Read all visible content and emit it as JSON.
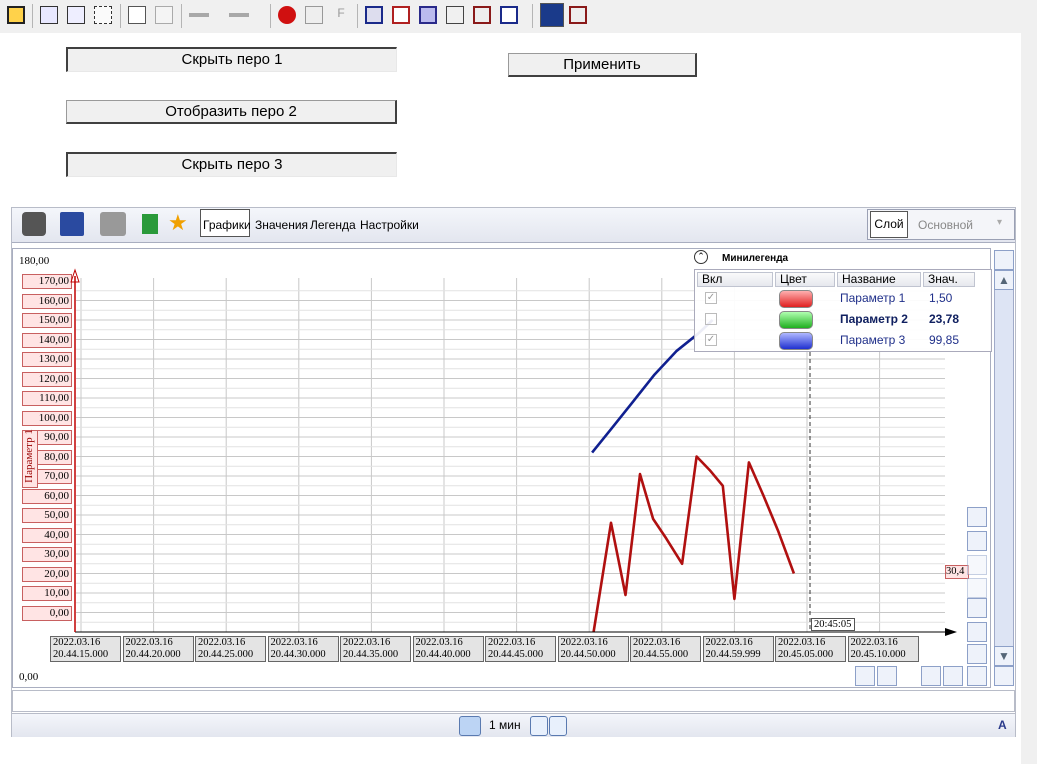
{
  "buttons": {
    "hide_pen_1": "Скрыть перо 1",
    "show_pen_2": "Отобразить перо 2",
    "hide_pen_3": "Скрыть перо 3",
    "apply": "Применить"
  },
  "trend_toolbar": {
    "tabs": [
      "Графики",
      "Значения",
      "Легенда",
      "Настройки"
    ],
    "layer_button": "Слой",
    "layer_value": "Основной"
  },
  "plot": {
    "top_value": "180,00",
    "bottom_value": "0,00",
    "axis_label": "Параметр 1",
    "cursor_time": "20:45:05",
    "cursor_value": "30,4",
    "y_ticks": [
      "180,00",
      "170,00",
      "160,00",
      "150,00",
      "140,00",
      "130,00",
      "120,00",
      "110,00",
      "100,00",
      "90,00",
      "80,00",
      "70,00",
      "60,00",
      "50,00",
      "40,00",
      "30,00",
      "20,00",
      "10,00",
      "0,00"
    ],
    "x_labels": [
      {
        "date": "2022.03.16",
        "time": "20.44.15.000"
      },
      {
        "date": "2022.03.16",
        "time": "20.44.20.000"
      },
      {
        "date": "2022.03.16",
        "time": "20.44.25.000"
      },
      {
        "date": "2022.03.16",
        "time": "20.44.30.000"
      },
      {
        "date": "2022.03.16",
        "time": "20.44.35.000"
      },
      {
        "date": "2022.03.16",
        "time": "20.44.40.000"
      },
      {
        "date": "2022.03.16",
        "time": "20.44.45.000"
      },
      {
        "date": "2022.03.16",
        "time": "20.44.50.000"
      },
      {
        "date": "2022.03.16",
        "time": "20.44.55.000"
      },
      {
        "date": "2022.03.16",
        "time": "20.44.59.999"
      },
      {
        "date": "2022.03.16",
        "time": "20.45.05.000"
      },
      {
        "date": "2022.03.16",
        "time": "20.45.10.000"
      }
    ]
  },
  "chart_data": {
    "type": "line",
    "ylim": [
      0,
      180
    ],
    "series": [
      {
        "name": "Параметр 1",
        "color": "#b01010",
        "points": [
          [
            50.3,
            0
          ],
          [
            51.5,
            56
          ],
          [
            52.5,
            19
          ],
          [
            53.5,
            81
          ],
          [
            54.4,
            58
          ],
          [
            55.3,
            48
          ],
          [
            56.4,
            35
          ],
          [
            57.4,
            90
          ],
          [
            58.3,
            83
          ],
          [
            59.2,
            75
          ],
          [
            60.0,
            17
          ],
          [
            61.0,
            87
          ],
          [
            62.0,
            70
          ],
          [
            63.0,
            52
          ],
          [
            64.1,
            30
          ]
        ]
      },
      {
        "name": "Параметр 3",
        "color": "#102090",
        "points": [
          [
            50.2,
            92
          ],
          [
            51.5,
            104
          ],
          [
            53,
            118
          ],
          [
            54.5,
            132
          ],
          [
            56,
            144
          ],
          [
            57.5,
            153
          ],
          [
            58.5,
            160
          ]
        ]
      }
    ]
  },
  "legend": {
    "title": "Минилегенда",
    "headers": [
      "Вкл",
      "Цвет",
      "Название",
      "Знач."
    ],
    "rows": [
      {
        "name": "Параметр 1",
        "value": "1,50",
        "color": "#e03030",
        "enabled": true
      },
      {
        "name": "Параметр 2",
        "value": "23,78",
        "color": "#20b020",
        "enabled": false
      },
      {
        "name": "Параметр 3",
        "value": "99,85",
        "color": "#2030d0",
        "enabled": true
      }
    ]
  },
  "bottom_bar": {
    "interval": "1 мин",
    "corner_label": "A"
  },
  "colors": {
    "axis_red": "#c00000",
    "grid": "#c8c8c8"
  }
}
